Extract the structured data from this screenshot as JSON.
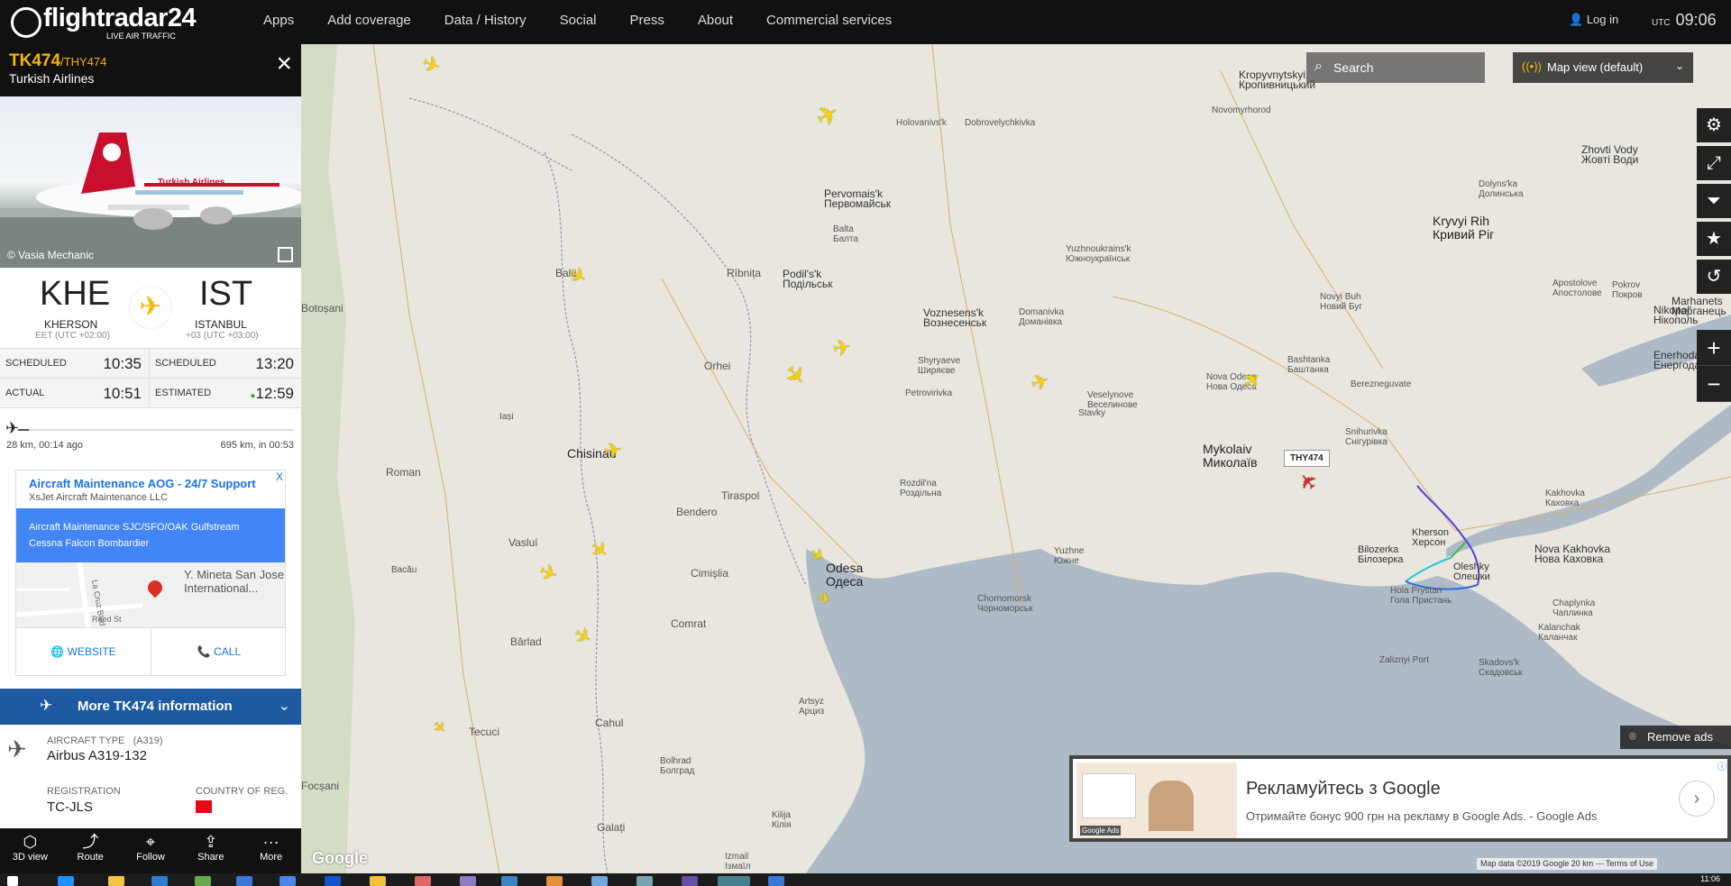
{
  "header": {
    "logo_text": "flightradar24",
    "logo_tagline": "LIVE AIR TRAFFIC",
    "nav": [
      "Apps",
      "Add coverage",
      "Data / History",
      "Social",
      "Press",
      "About",
      "Commercial services"
    ],
    "login_label": "Log in",
    "utc_label": "UTC",
    "utc_time": "09:06"
  },
  "flight": {
    "number": "TK474",
    "callsign": "/THY474",
    "airline": "Turkish Airlines",
    "photo_credit": "© Vasia Mechanic",
    "origin": {
      "code": "KHE",
      "city": "KHERSON",
      "tz": "EET (UTC +02:00)"
    },
    "destination": {
      "code": "IST",
      "city": "ISTANBUL",
      "tz": "+03 (UTC +03:00)"
    },
    "times": {
      "scheduled_dep_label": "SCHEDULED",
      "scheduled_dep": "10:35",
      "scheduled_arr_label": "SCHEDULED",
      "scheduled_arr": "13:20",
      "actual_dep_label": "ACTUAL",
      "actual_dep": "10:51",
      "estimated_arr_label": "ESTIMATED",
      "estimated_arr": "12:59"
    },
    "progress": {
      "fraction": 0.04,
      "left_text": "28 km, 00:14 ago",
      "right_text": "695 km, in 00:53"
    }
  },
  "sidebar_ad": {
    "title": "Aircraft Maintenance AOG - 24/7 Support",
    "company": "XsJet Aircraft Maintenance LLC",
    "body": "Aircraft Maintenance SJC/SFO/OAK Gulfstream Cessna Falcon Bombardier",
    "map_label": "Y. Mineta San Jose International...",
    "map_street_1": "La Cruz Blvd",
    "map_street_2": "Reed St",
    "website_label": "WEBSITE",
    "call_label": "CALL",
    "close": "X"
  },
  "more_info": {
    "label": "More TK474 information",
    "aircraft_type_label": "AIRCRAFT TYPE",
    "aircraft_type_code": "(A319)",
    "aircraft_type": "Airbus A319-132",
    "registration_label": "REGISTRATION",
    "registration": "TC-JLS",
    "country_label": "COUNTRY OF REG."
  },
  "bottom_tools": [
    {
      "label": "3D view",
      "icon": "cube-icon"
    },
    {
      "label": "Route",
      "icon": "route-icon"
    },
    {
      "label": "Follow",
      "icon": "follow-icon"
    },
    {
      "label": "Share",
      "icon": "share-icon"
    },
    {
      "label": "More",
      "icon": "more-icon"
    }
  ],
  "map": {
    "search_placeholder": "Search",
    "map_view_label": "Map view (default)",
    "flight_label": "THY474",
    "remove_ads": "Remove ads",
    "google": "Google",
    "attribution": "Map data ©2019 Google   20 km ⎯⎯   Terms of Use",
    "cities": [
      {
        "name": "Chisinau"
      },
      {
        "name": "Odesa\nОдеса"
      },
      {
        "name": "Mykolaiv\nМиколаїв"
      },
      {
        "name": "Kryvyi Rih\nКривий Ріг"
      },
      {
        "name": "Kropyvnytskyi\nКропивницький"
      },
      {
        "name": "Nikopol'\nНікополь"
      },
      {
        "name": "Enerhodar\nЕнергодар"
      },
      {
        "name": "Marhanets\nМарганець"
      },
      {
        "name": "Kherson\nХерсон"
      },
      {
        "name": "Oleshky\nОлешки"
      },
      {
        "name": "Bilozerka\nБілозерка"
      },
      {
        "name": "Hola Prystan\nГола Пристань"
      },
      {
        "name": "Nova Kakhovka\nНова Каховка"
      },
      {
        "name": "Kakhovka\nКаховка"
      },
      {
        "name": "Voznesens'k\nВознесенськ"
      },
      {
        "name": "Pervomais'k\nПервомайськ"
      },
      {
        "name": "Iași"
      },
      {
        "name": "Bacău"
      },
      {
        "name": "Tiraspol"
      },
      {
        "name": "Bendero"
      },
      {
        "name": "Chornomorsk\nЧорноморськ"
      },
      {
        "name": "Yuzhne\nЮжне"
      },
      {
        "name": "Vasluí"
      },
      {
        "name": "Bârlad"
      },
      {
        "name": "Cahul"
      },
      {
        "name": "Comrat"
      },
      {
        "name": "Cimișlia"
      },
      {
        "name": "Botoșani"
      },
      {
        "name": "Roman"
      },
      {
        "name": "Balti"
      },
      {
        "name": "Orhei"
      },
      {
        "name": "Rîbnița"
      },
      {
        "name": "Focșani"
      },
      {
        "name": "Tecuci"
      },
      {
        "name": "Galați"
      },
      {
        "name": "Izmail\nІзмаїл"
      },
      {
        "name": "Novomyrhorod"
      },
      {
        "name": "Berezneguvate"
      },
      {
        "name": "Snihurivka\nСнігурівка"
      },
      {
        "name": "Skadovs'k\nСкадовськ"
      },
      {
        "name": "Zaliznyi Port"
      },
      {
        "name": "Kalanchak\nКаланчак"
      },
      {
        "name": "Chaplynka\nЧаплинка"
      },
      {
        "name": "Nova Odesa\nНова Одеса"
      },
      {
        "name": "Bashtanka\nБаштанка"
      },
      {
        "name": "Novyi Buh\nНовий Буг"
      },
      {
        "name": "Zhovti Vody\nЖовті Води"
      },
      {
        "name": "Dolyns'ka\nДолинська"
      },
      {
        "name": "Apostolove\nАпостолове"
      },
      {
        "name": "Pokrov\nПокров"
      },
      {
        "name": "Dobrovelychkivka"
      },
      {
        "name": "Holovanivs'k"
      },
      {
        "name": "Podil's'k\nПодільськ"
      },
      {
        "name": "Balta\nБалта"
      },
      {
        "name": "Yuzhnoukrains'k\nЮжноукраїнськ"
      },
      {
        "name": "Domanivka\nДоманівка"
      },
      {
        "name": "Shyryaeve\nШиряєве"
      },
      {
        "name": "Petrovirivka"
      },
      {
        "name": "Veselynove\nВеселинове"
      },
      {
        "name": "Stavky"
      },
      {
        "name": "Rozdil'na\nРоздільна"
      },
      {
        "name": "Artsyz\nАрциз"
      },
      {
        "name": "Bolhrad\nБолград"
      },
      {
        "name": "Kilija\nКілія"
      }
    ]
  },
  "google_ad": {
    "title": "Рекламуйтесь з Google",
    "desc": "Отримайте бонус 900 грн на рекламу в Google Ads. - Google Ads",
    "img_label": "Google Ads"
  },
  "taskbar": {
    "clock": "11:06"
  },
  "colors": {
    "accent": "#f7b500",
    "nav_bg": "#111111",
    "more_bar": "#1d5aa2",
    "map_water": "#aebbc6",
    "plane": "#f7d400"
  }
}
